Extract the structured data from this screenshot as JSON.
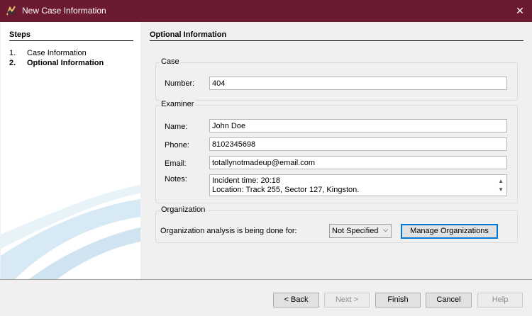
{
  "window": {
    "title": "New Case Information",
    "close_glyph": "✕"
  },
  "sidebar": {
    "heading": "Steps",
    "steps": [
      {
        "num": "1.",
        "label": "Case Information"
      },
      {
        "num": "2.",
        "label": "Optional Information"
      }
    ]
  },
  "main": {
    "heading": "Optional Information",
    "case": {
      "legend": "Case",
      "number_label": "Number:",
      "number_value": "404"
    },
    "examiner": {
      "legend": "Examiner",
      "name_label": "Name:",
      "name_value": "John Doe",
      "phone_label": "Phone:",
      "phone_value": "8102345698",
      "email_label": "Email:",
      "email_value": "totallynotmadeup@email.com",
      "notes_label": "Notes:",
      "notes_line1": "Incident time: 20:18",
      "notes_line2": "Location: Track 255, Sector 127, Kingston."
    },
    "organization": {
      "legend": "Organization",
      "label": "Organization analysis is being done for:",
      "selected": "Not Specified",
      "manage_button": "Manage Organizations"
    }
  },
  "footer": {
    "back": "< Back",
    "next": "Next >",
    "finish": "Finish",
    "cancel": "Cancel",
    "help": "Help"
  },
  "colors": {
    "titlebar": "#6b1a32",
    "focus": "#0078d7"
  }
}
